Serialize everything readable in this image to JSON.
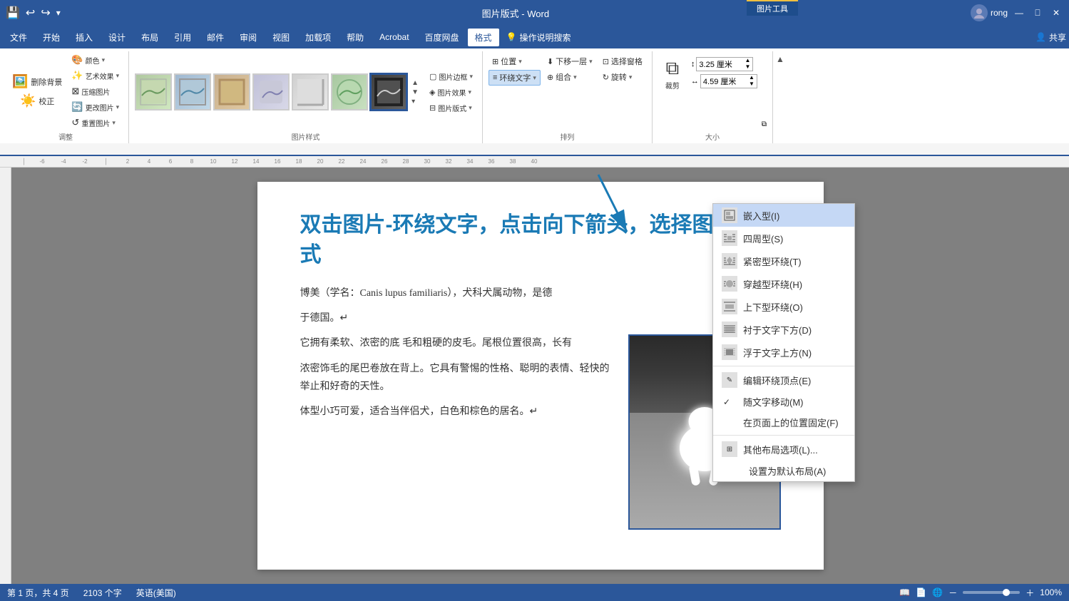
{
  "titlebar": {
    "title": "图片版式 - Word",
    "picture_tools_label": "图片工具",
    "user": "rong",
    "save_icon": "💾",
    "undo_icon": "↩",
    "redo_icon": "↪",
    "minimize": "🗕",
    "restore": "🗗",
    "close": "✕"
  },
  "menubar": {
    "items": [
      "文件",
      "开始",
      "插入",
      "设计",
      "布局",
      "引用",
      "邮件",
      "审阅",
      "视图",
      "加载项",
      "帮助",
      "Acrobat",
      "百度网盘"
    ],
    "active": "格式",
    "picture_icon": "💡",
    "operation_search": "操作说明搜索",
    "share": "共享"
  },
  "toolbar": {
    "adjust_group": {
      "label": "调整",
      "remove_bg": "删除背景",
      "correct": "校正",
      "color": "颜色▾",
      "art_effect": "艺术效果▾",
      "compress": "压缩图片",
      "change_pic": "更改图片▾",
      "reset_pic": "重置图片▾"
    },
    "picture_styles_group": {
      "label": "图片样式",
      "styles": [
        "style1",
        "style2",
        "style3",
        "style4",
        "style5",
        "style6",
        "style7"
      ],
      "border_btn": "图片边框▾",
      "effect_btn": "图片效果▾",
      "layout_btn": "图片版式▾"
    },
    "arrange_group": {
      "label": "排列",
      "position_btn": "位置▾",
      "wrap_text_btn": "环绕文字▾",
      "move_back": "下移一层▾",
      "combine": "组合▾",
      "select_pane": "选择窗格",
      "rotate": "旋转▾"
    },
    "size_group": {
      "label": "大小",
      "height": "3.25 厘米",
      "width": "4.59 厘米",
      "crop_btn": "裁剪"
    }
  },
  "wrap_text_menu": {
    "items": [
      {
        "icon": "inline",
        "label": "嵌入型(I)",
        "shortcut": "",
        "highlighted": true
      },
      {
        "icon": "square",
        "label": "四周型(S)",
        "shortcut": ""
      },
      {
        "icon": "tight",
        "label": "紧密型环绕(T)",
        "shortcut": ""
      },
      {
        "icon": "through",
        "label": "穿越型环绕(H)",
        "shortcut": ""
      },
      {
        "icon": "topbottom",
        "label": "上下型环绕(O)",
        "shortcut": ""
      },
      {
        "icon": "behind",
        "label": "衬于文字下方(D)",
        "shortcut": ""
      },
      {
        "icon": "infront",
        "label": "浮于文字上方(N)",
        "shortcut": ""
      },
      {
        "divider": true
      },
      {
        "icon": "editpoints",
        "label": "编辑环绕顶点(E)",
        "shortcut": ""
      },
      {
        "check": true,
        "label": "随文字移动(M)",
        "shortcut": ""
      },
      {
        "label": "在页面上的位置固定(F)",
        "shortcut": ""
      },
      {
        "divider": true
      },
      {
        "icon": "other",
        "label": "其他布局选项(L)...",
        "shortcut": ""
      },
      {
        "label": "设置为默认布局(A)",
        "shortcut": ""
      }
    ]
  },
  "document": {
    "instruction": "双击图片-环绕文字，点击向下箭头，选择图片的版式",
    "paragraph1": "博美（学名：Canis lupus familiaris），犬科犬属动物，是德",
    "paragraph1_end": "于德国。↵",
    "paragraph2_prefix": "它拥有柔软、浓密的底",
    "paragraph2_mid": "毛和粗硬的皮毛。尾根位置很高，长有",
    "paragraph2_end": "浓密饰毛的尾巴卷放在背上。它具有警惕的性格、聪明的表情、轻快的举止和好奇的天性。",
    "paragraph3": "体型小巧可爱，适合当伴侣犬，白色和棕色的居名。↵"
  },
  "statusbar": {
    "pages": "第 1 页，共 4 页",
    "words": "2103 个字",
    "lang": "英语(美国)",
    "zoom": "100%",
    "zoom_value": 100
  }
}
